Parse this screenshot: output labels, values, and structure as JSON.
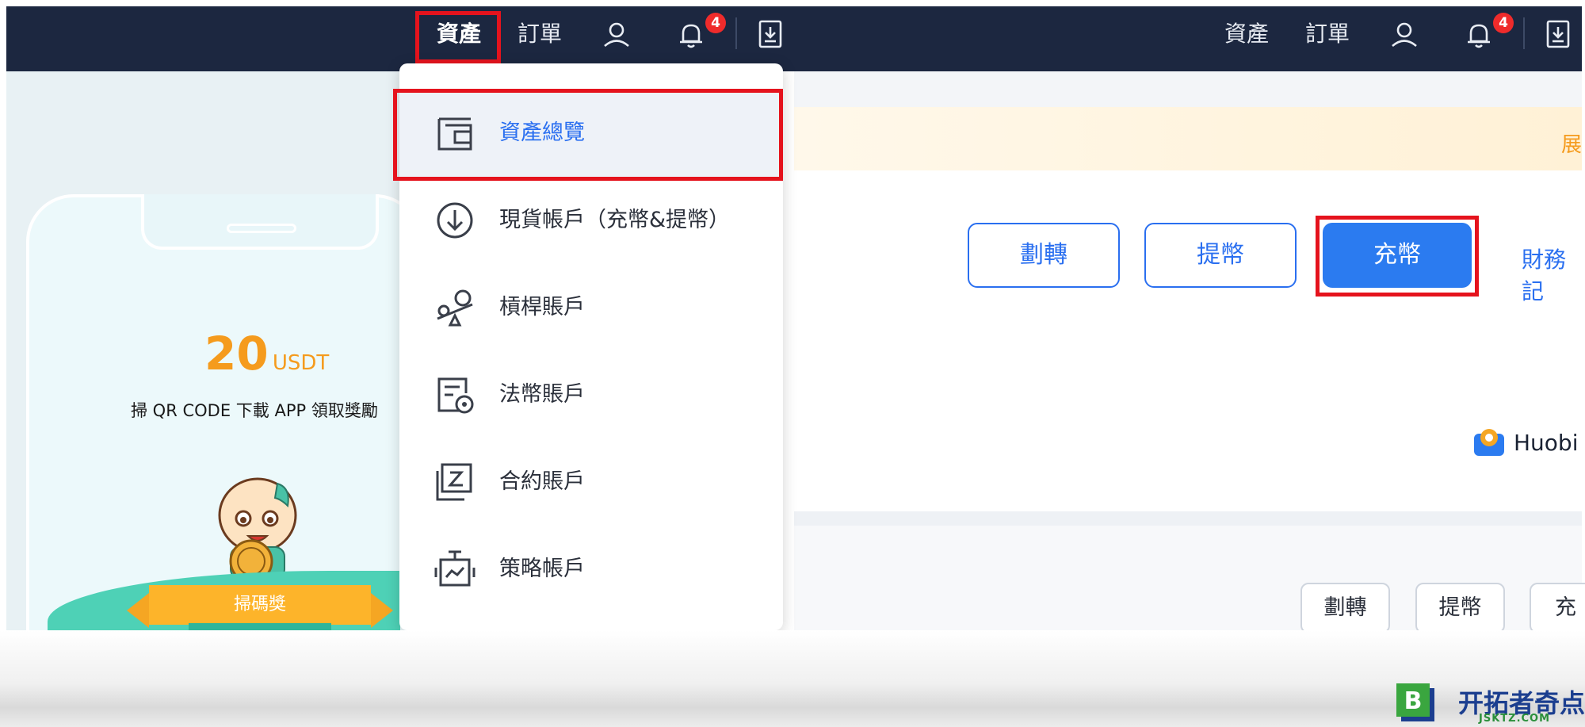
{
  "navbar_left": {
    "assets_label": "資產",
    "orders_label": "訂單",
    "badge_count": "4"
  },
  "navbar_right": {
    "assets_label": "資產",
    "orders_label": "訂單",
    "badge_count": "4"
  },
  "promo": {
    "amount": "20",
    "unit": "USDT",
    "subtitle": "掃 QR CODE 下載 APP 領取獎勵",
    "ribbon": "掃碼獎"
  },
  "dropdown": {
    "items": [
      {
        "label": "資產總覽",
        "icon": "wallet-icon"
      },
      {
        "label": "現貨帳戶（充幣&提幣）",
        "icon": "download-circle-icon"
      },
      {
        "label": "槓桿賬戶",
        "icon": "leverage-icon"
      },
      {
        "label": "法幣賬戶",
        "icon": "fiat-icon"
      },
      {
        "label": "合約賬戶",
        "icon": "contract-icon"
      },
      {
        "label": "策略帳戶",
        "icon": "strategy-icon"
      }
    ]
  },
  "right_panel": {
    "notice_text": "展",
    "buttons": {
      "transfer": "劃轉",
      "withdraw": "提幣",
      "deposit": "充幣"
    },
    "finance_link": "財務記",
    "huobi_text": "Huobi",
    "lower_buttons": {
      "transfer": "劃轉",
      "withdraw": "提幣",
      "deposit": "充"
    }
  },
  "watermark": {
    "logo_letter": "B",
    "name": "开拓者奇点",
    "domain": "JSKTZ.COM"
  },
  "colors": {
    "nav_bg": "#1c2740",
    "accent_blue": "#2a6ff0",
    "highlight_red": "#e5131d",
    "promo_orange": "#f59b1d",
    "badge_red": "#ef2b2b"
  }
}
